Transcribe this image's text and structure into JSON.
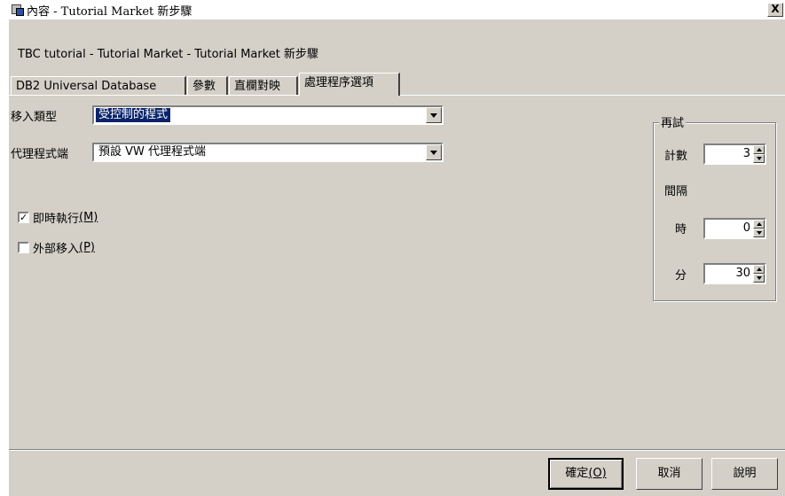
{
  "window": {
    "title": "內容 - Tutorial Market 新步驟",
    "close_label": "X"
  },
  "path_text": "TBC tutorial - Tutorial Market - Tutorial Market 新步驟",
  "tabs": [
    {
      "label": "DB2 Universal Database",
      "active": false
    },
    {
      "label": "參數",
      "active": false
    },
    {
      "label": "直欄對映",
      "active": false
    },
    {
      "label": "處理程序選項",
      "active": true
    }
  ],
  "form": {
    "populate_type_label": "移入類型",
    "populate_type_value": "受控制的程式",
    "agent_site_label": "代理程式端",
    "agent_site_value": "預設 VW 代理程式端",
    "run_now": {
      "label": "即時執行",
      "mnemonic": "(M)",
      "checked": true
    },
    "external_populate": {
      "label": "外部移入",
      "mnemonic": "(P)",
      "checked": false
    }
  },
  "retry": {
    "group_title": "再試",
    "count_label": "計數",
    "count_value": "3",
    "interval_label": "間隔",
    "hours_label": "時",
    "hours_value": "0",
    "minutes_label": "分",
    "minutes_value": "30"
  },
  "buttons": {
    "ok": {
      "label": "確定",
      "mnemonic": "(O)"
    },
    "cancel": "取消",
    "help": "說明"
  },
  "colors": {
    "dialog_bg": "#d4d0c8",
    "selection": "#0a246a"
  }
}
